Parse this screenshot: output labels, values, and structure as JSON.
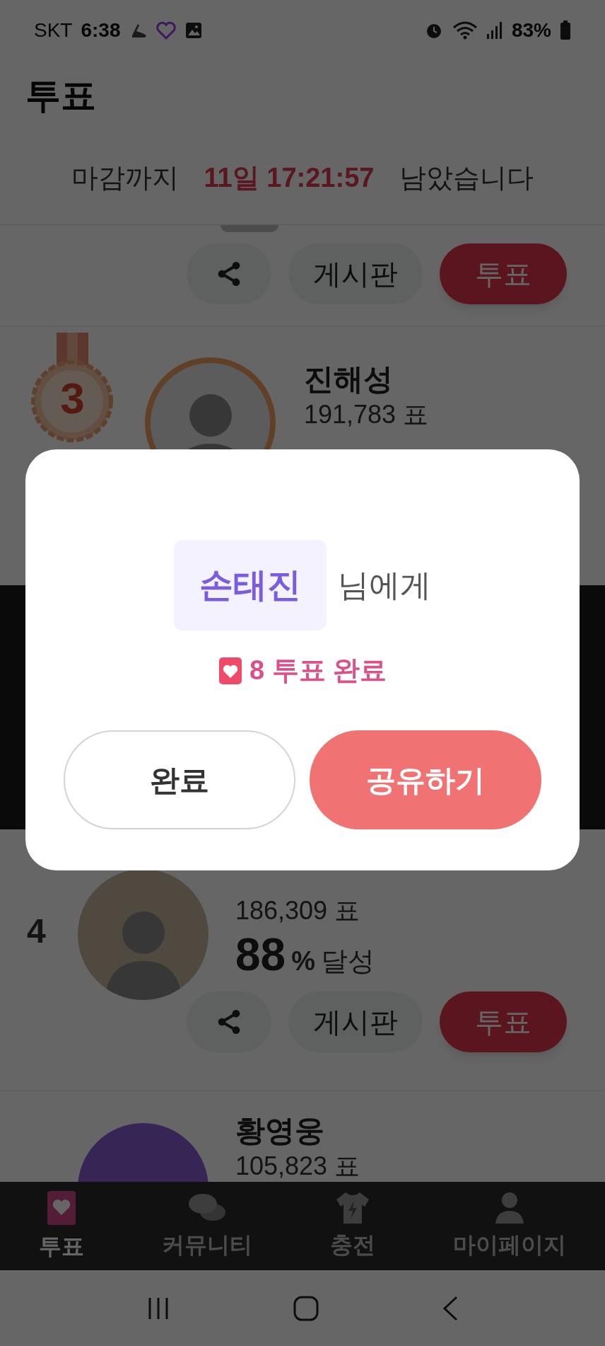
{
  "status_bar": {
    "carrier": "SKT",
    "time": "6:38",
    "battery": "83%"
  },
  "header": {
    "title": "투표"
  },
  "deadline": {
    "prefix": "마감까지",
    "remaining": "11일 17:21:57",
    "suffix": "남았습니다"
  },
  "candidates": [
    {
      "kind": "buttons_only",
      "board": "게시판",
      "vote": "투표"
    },
    {
      "kind": "medal",
      "rank": "3",
      "name": "진해성",
      "votes": "191,783 표"
    },
    {
      "kind": "full",
      "rank": "4",
      "votes": "186,309 표",
      "percent": "88",
      "unit": "%",
      "achieved": "달성",
      "board": "게시판",
      "vote": "투표"
    },
    {
      "kind": "top",
      "name": "황영웅",
      "votes": "105,823 표"
    }
  ],
  "dialog": {
    "recipient": "손태진",
    "recipient_suffix": "님에게",
    "count": "8",
    "message": "투표 완료",
    "buttons": [
      {
        "label": "완료",
        "kind": "secondary"
      },
      {
        "label": "공유하기",
        "kind": "primary"
      }
    ]
  },
  "bottom_nav": [
    {
      "label": "투표",
      "selected": true
    },
    {
      "label": "커뮤니티",
      "selected": false
    },
    {
      "label": "충전",
      "selected": false
    },
    {
      "label": "마이페이지",
      "selected": false
    }
  ]
}
